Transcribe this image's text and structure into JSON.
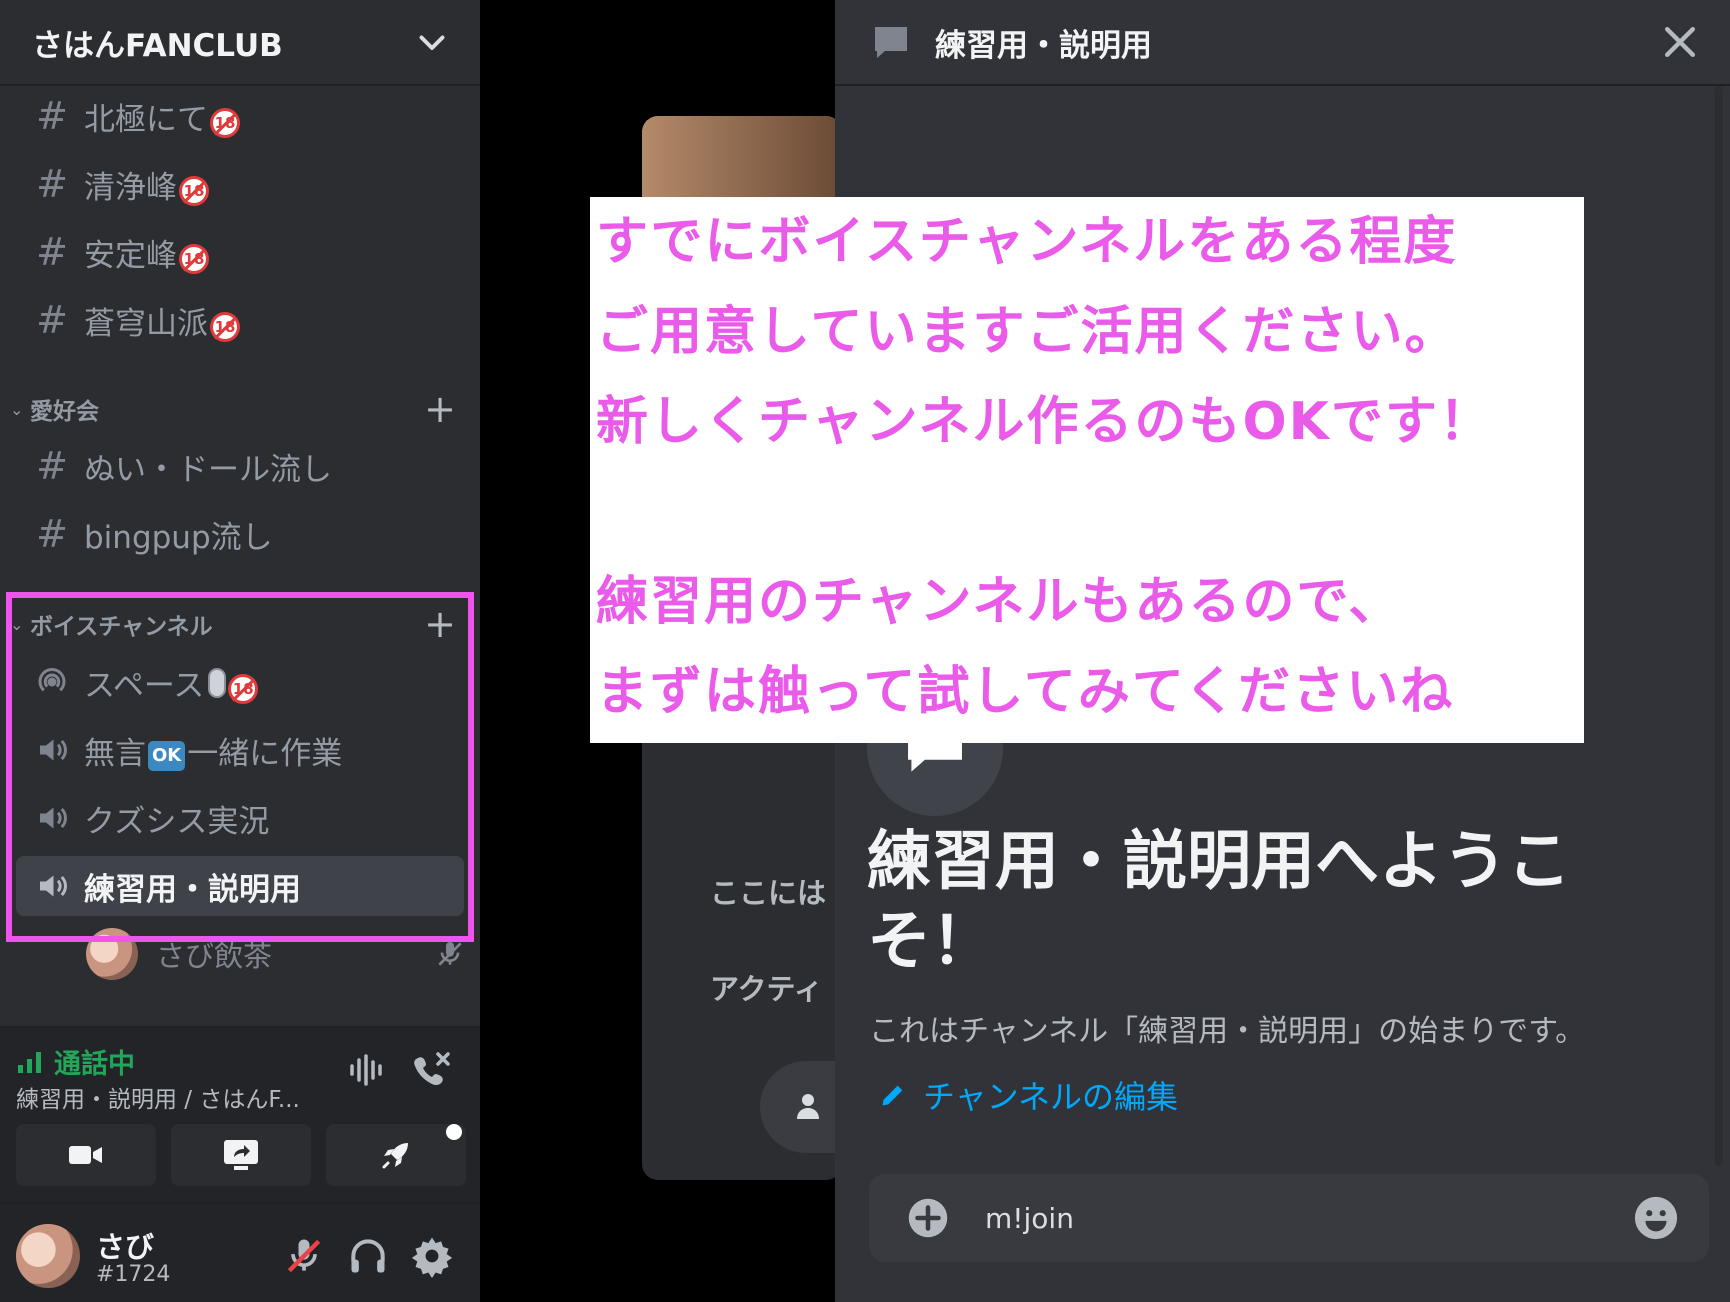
{
  "server": {
    "name": "さはんFANCLUB"
  },
  "channels_top": [
    {
      "name": "北極にて"
    },
    {
      "name": "清浄峰"
    },
    {
      "name": "安定峰"
    },
    {
      "name": "蒼穹山派"
    }
  ],
  "category_hobby": {
    "label": "愛好会",
    "channels": [
      {
        "name": "ぬい・ドール流し"
      },
      {
        "name": "bingpup流し"
      }
    ]
  },
  "category_voice": {
    "label": "ボイスチャンネル",
    "channels": [
      {
        "name": "スペース"
      },
      {
        "name_before": "無言",
        "ok_text": "OK",
        "name_after": "一緒に作業"
      },
      {
        "name": "クズシス実況"
      },
      {
        "name": "練習用・説明用"
      }
    ],
    "connected_user": "さび飲茶"
  },
  "voice_status": {
    "status": "通話中",
    "channel_path": "練習用・説明用 / さはんF..."
  },
  "user": {
    "name": "さび",
    "tag": "#1724"
  },
  "stage_preview": {
    "line1": "ここには",
    "line2": "アクティ"
  },
  "thread_panel": {
    "title": "練習用・説明用",
    "welcome_title": "練習用・説明用へようこそ！",
    "welcome_subtitle": "これはチャンネル「練習用・説明用」の始まりです。",
    "edit_link": "チャンネルの編集",
    "composer_text": "m!join"
  },
  "annotation": {
    "lines": [
      "すでにボイスチャンネルをある程度",
      "ご用意していますご活用ください。",
      "新しくチャンネル作るのもOKです！",
      "",
      "練習用のチャンネルもあるので、",
      "まずは触って試してみてくださいね"
    ],
    "text_color": "#ea5be9",
    "highlight_color": "#ee55ee"
  },
  "colors": {
    "sidebar_bg": "#2b2d31",
    "panel_bg": "#313338",
    "connected_green": "#23a55a",
    "link_blue": "#00a8fc"
  }
}
